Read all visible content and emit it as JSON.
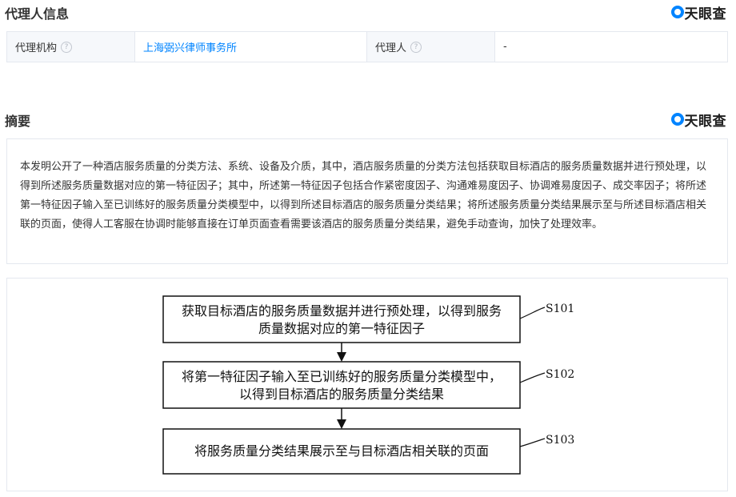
{
  "agent_section": {
    "title": "代理人信息",
    "brand": "天眼查",
    "agency_label": "代理机构",
    "agency_value": "上海弼兴律师事务所",
    "agent_label": "代理人",
    "agent_value": "-"
  },
  "abstract_section": {
    "title": "摘要",
    "brand": "天眼查",
    "text": "本发明公开了一种酒店服务质量的分类方法、系统、设备及介质，其中，酒店服务质量的分类方法包括获取目标酒店的服务质量数据并进行预处理，以得到所述服务质量数据对应的第一特征因子；其中，所述第一特征因子包括合作紧密度因子、沟通难易度因子、协调难易度因子、成交率因子；将所述第一特征因子输入至已训练好的服务质量分类模型中，以得到所述目标酒店的服务质量分类结果；将所述服务质量分类结果展示至与所述目标酒店相关联的页面，使得人工客服在协调时能够直接在订单页面查看需要该酒店的服务质量分类结果，避免手动查询，加快了处理效率。"
  },
  "flowchart": {
    "steps": [
      {
        "id": "S101",
        "lines": [
          "获取目标酒店的服务质量数据并进行预处理，以得到服务",
          "质量数据对应的第一特征因子"
        ]
      },
      {
        "id": "S102",
        "lines": [
          "将第一特征因子输入至已训练好的服务质量分类模型中，",
          "以得到目标酒店的服务质量分类结果"
        ]
      },
      {
        "id": "S103",
        "lines": [
          "将服务质量分类结果展示至与目标酒店相关联的页面"
        ]
      }
    ]
  }
}
